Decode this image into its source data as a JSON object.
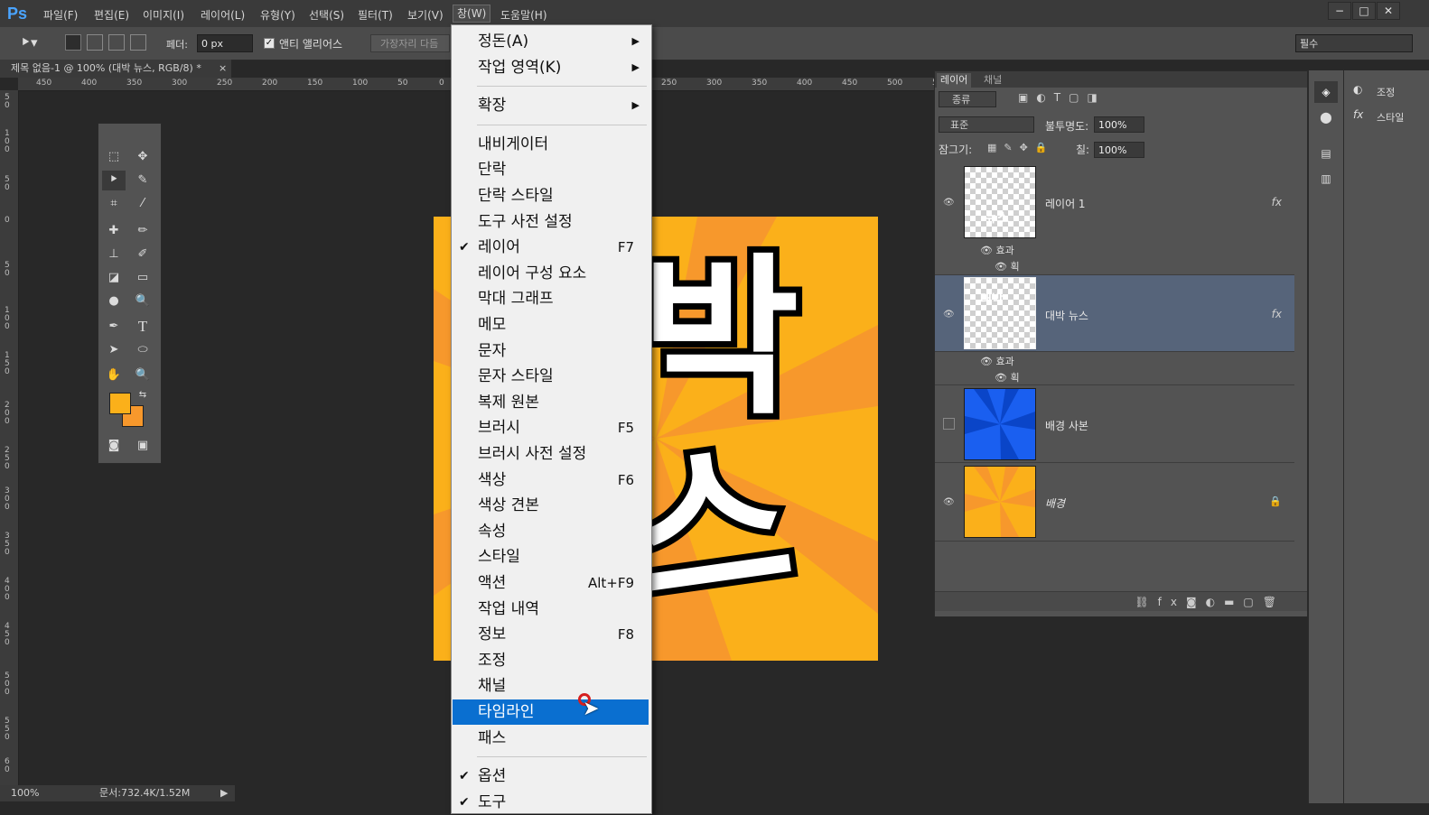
{
  "menubar": {
    "logo": "Ps",
    "items": [
      "파일(F)",
      "편집(E)",
      "이미지(I)",
      "레이어(L)",
      "유형(Y)",
      "선택(S)",
      "필터(T)",
      "보기(V)",
      "창(W)",
      "도움말(H)"
    ],
    "active_item": "창(W)",
    "window_buttons": [
      "−",
      "□",
      "✕"
    ]
  },
  "options_bar": {
    "feather_label": "페더:",
    "feather_value": "0 px",
    "antialias_label": "앤티 앨리어스",
    "refine_edge_button": "가장자리 다듬",
    "workspace_select": "필수"
  },
  "document": {
    "tab_title": "제목 없음-1 @ 100% (대박 뉴스, RGB/8) *",
    "tab_close": "×",
    "ruler_top_labels": [
      "450",
      "400",
      "350",
      "300",
      "250",
      "200",
      "150",
      "100",
      "50",
      "0",
      "250",
      "300",
      "350",
      "400",
      "450",
      "500",
      "55"
    ],
    "ruler_left_labels": [
      "5\n0",
      "1\n0\n0",
      "5\n0",
      "0",
      "5\n0",
      "1\n0\n0",
      "1\n5\n0",
      "2\n0\n0",
      "2\n5\n0",
      "3\n0\n0",
      "3\n5\n0",
      "4\n0\n0",
      "4\n5\n0",
      "5\n0\n0",
      "5\n5\n0",
      "6\n0"
    ],
    "canvas_text_line1": "박",
    "canvas_text_line2": "스",
    "colors": {
      "canvas_bg": "#fbb01a",
      "ray": "#f7982c"
    }
  },
  "window_menu": {
    "items": [
      {
        "label": "정돈(A)",
        "submenu": true
      },
      {
        "label": "작업 영역(K)",
        "submenu": true
      },
      {
        "sep": true
      },
      {
        "label": "확장",
        "submenu": true
      },
      {
        "sep": true
      },
      {
        "label": "내비게이터"
      },
      {
        "label": "단락"
      },
      {
        "label": "단락 스타일"
      },
      {
        "label": "도구 사전 설정"
      },
      {
        "label": "레이어",
        "checked": true,
        "shortcut": "F7"
      },
      {
        "label": "레이어 구성 요소"
      },
      {
        "label": "막대 그래프"
      },
      {
        "label": "메모"
      },
      {
        "label": "문자"
      },
      {
        "label": "문자 스타일"
      },
      {
        "label": "복제 원본"
      },
      {
        "label": "브러시",
        "shortcut": "F5"
      },
      {
        "label": "브러시 사전 설정"
      },
      {
        "label": "색상",
        "shortcut": "F6"
      },
      {
        "label": "색상 견본"
      },
      {
        "label": "속성"
      },
      {
        "label": "스타일"
      },
      {
        "label": "액션",
        "shortcut": "Alt+F9"
      },
      {
        "label": "작업 내역"
      },
      {
        "label": "정보",
        "shortcut": "F8"
      },
      {
        "label": "조정"
      },
      {
        "label": "채널"
      },
      {
        "label": "타임라인",
        "highlighted": true
      },
      {
        "label": "패스"
      },
      {
        "sep": true
      },
      {
        "label": "옵션",
        "checked": true
      },
      {
        "label": "도구",
        "checked": true
      }
    ]
  },
  "layers_panel": {
    "tabs": [
      "레이어",
      "채널"
    ],
    "filter_label": "종류",
    "blend_mode": "표준",
    "opacity_label": "불투명도:",
    "opacity_value": "100%",
    "lock_label": "잠그기:",
    "fill_label": "칠:",
    "fill_value": "100%",
    "layers": [
      {
        "name": "레이어 1",
        "thumb_text": "뉴스",
        "fx": "fx",
        "effects_label": "효과",
        "effect": "획"
      },
      {
        "name": "대박 뉴스",
        "thumb_text": "대박",
        "fx": "fx",
        "effects_label": "효과",
        "effect": "획",
        "selected": true
      },
      {
        "name": "배경 사본"
      },
      {
        "name": "배경",
        "locked": true
      }
    ]
  },
  "dock": {
    "adjustments_label": "조정",
    "styles_label": "스타일"
  },
  "status_bar": {
    "zoom": "100%",
    "doc_info": "문서:732.4K/1.52M"
  }
}
